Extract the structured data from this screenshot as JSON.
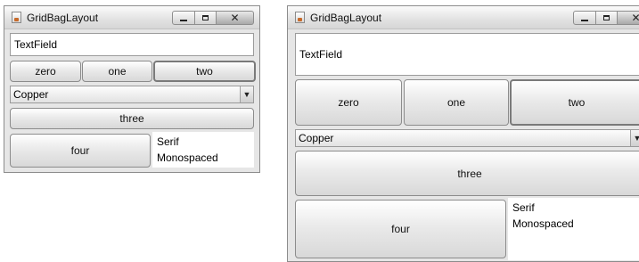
{
  "windows": [
    {
      "title": "GridBagLayout",
      "textfield_value": "TextField",
      "buttons": {
        "zero": "zero",
        "one": "one",
        "two": "two",
        "three": "three",
        "four": "four"
      },
      "combo_selected": "Copper",
      "list_items": [
        "Serif",
        "Monospaced"
      ]
    },
    {
      "title": "GridBagLayout",
      "textfield_value": "TextField",
      "buttons": {
        "zero": "zero",
        "one": "one",
        "two": "two",
        "three": "three",
        "four": "four"
      },
      "combo_selected": "Copper",
      "list_items": [
        "Serif",
        "Monospaced"
      ]
    }
  ],
  "icons": {
    "app": "java-app-icon",
    "minimize": "minimize-icon",
    "maximize": "maximize-icon",
    "close": "close-icon",
    "combo_arrow": "chevron-down-icon"
  }
}
